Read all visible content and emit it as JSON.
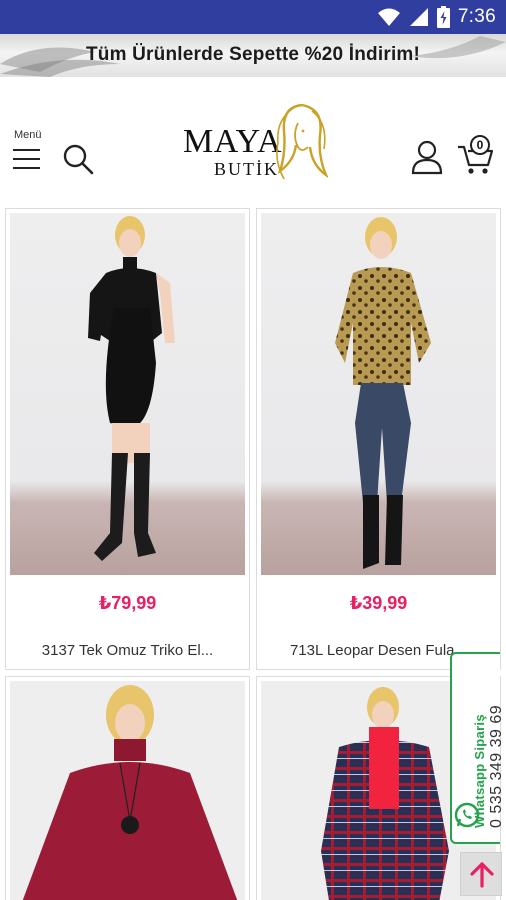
{
  "status_bar": {
    "time": "7:36",
    "icons": [
      "wifi-icon",
      "signal-icon",
      "battery-icon"
    ]
  },
  "promo": {
    "text": "Tüm Ürünlerde Sepette %20 İndirim!"
  },
  "header": {
    "menu_label": "Menü",
    "logo_top": "MAYA",
    "logo_bottom": "BUTİK",
    "cart_count": "0"
  },
  "products": [
    {
      "price": "₺79,99",
      "name": "3137 Tek Omuz Triko El...",
      "outfit": "black-dress"
    },
    {
      "price": "₺39,99",
      "name": "713L Leopar Desen Fula...",
      "outfit": "leopard-shirt"
    },
    {
      "price": "",
      "name": "",
      "outfit": "red-sweater"
    },
    {
      "price": "",
      "name": "",
      "outfit": "plaid-coat"
    }
  ],
  "whatsapp": {
    "label": "Whatsapp Sipariş",
    "phone": "0 535 349 39 69"
  },
  "colors": {
    "status_bar": "#303f9f",
    "price": "#e91e63",
    "whatsapp": "#25a24a"
  }
}
